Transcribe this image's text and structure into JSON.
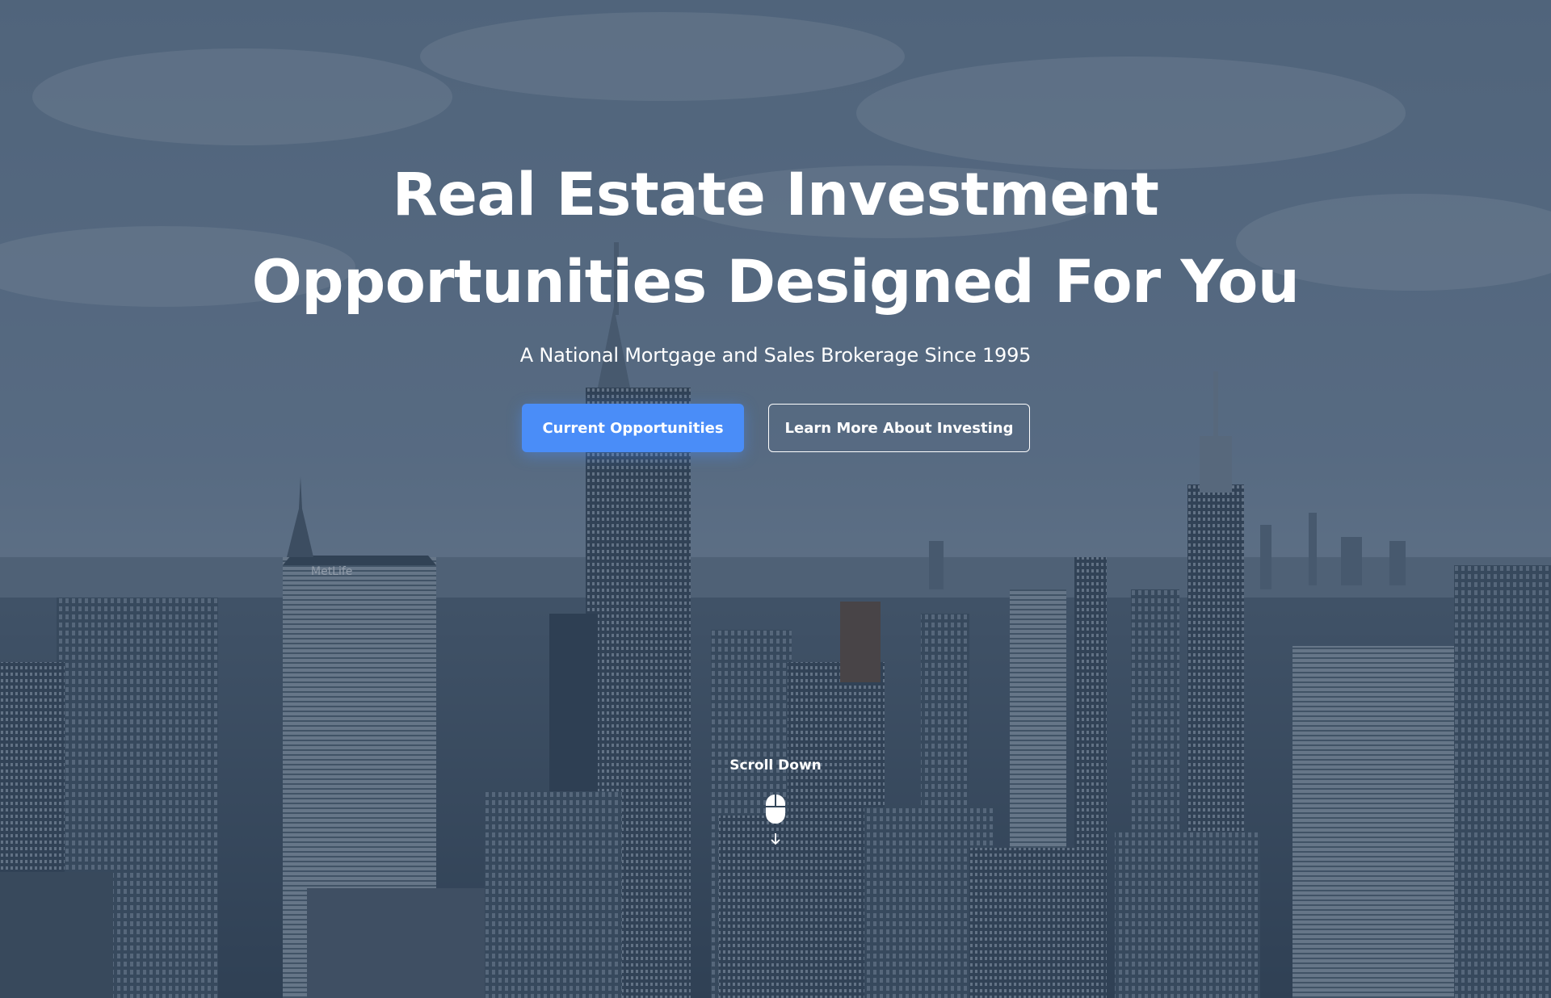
{
  "hero": {
    "title_line1": "Real Estate Investment",
    "title_line2": "Opportunities Designed For You",
    "subtitle": "A National Mortgage and Sales Brokerage Since 1995",
    "primary_button": "Current Opportunities",
    "secondary_button": "Learn More About Investing",
    "background_image": "city-skyline",
    "billboard_text": "MetLife"
  },
  "scroll": {
    "label": "Scroll Down",
    "icon": "mouse-icon",
    "arrow_icon": "arrow-down-icon"
  },
  "colors": {
    "accent": "#4a8df8",
    "overlay": "#243a54",
    "text": "#ffffff"
  }
}
